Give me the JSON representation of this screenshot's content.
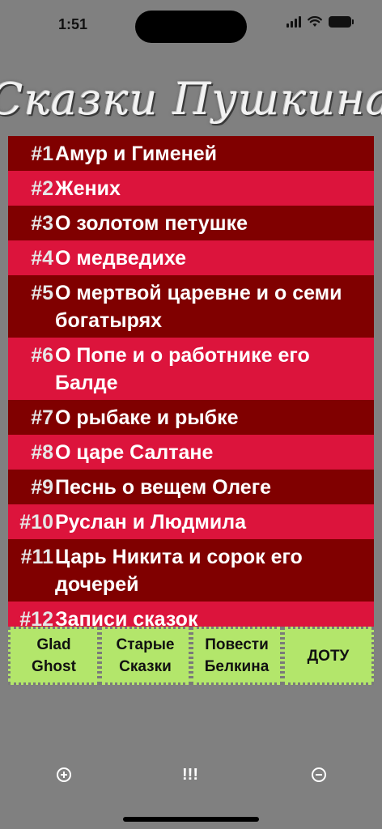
{
  "status_bar": {
    "time": "1:51"
  },
  "header": {
    "title": "Сказки Пушкина"
  },
  "tales": [
    {
      "num": "#1",
      "name": "Амур и Гименей"
    },
    {
      "num": "#2",
      "name": "Жених"
    },
    {
      "num": "#3",
      "name": "О золотом петушке"
    },
    {
      "num": "#4",
      "name": "О медведихе"
    },
    {
      "num": "#5",
      "name": "О мертвой царевне и о семи богатырях"
    },
    {
      "num": "#6",
      "name": "О Попе и о работнике его Балде"
    },
    {
      "num": "#7",
      "name": "О рыбаке и рыбке"
    },
    {
      "num": "#8",
      "name": "О царе Салтане"
    },
    {
      "num": "#9",
      "name": "Песнь о вещем Олеге"
    },
    {
      "num": "#10",
      "name": "Руслан и Людмила"
    },
    {
      "num": "#11",
      "name": "Царь Никита и сорок его дочерей"
    },
    {
      "num": "#12",
      "name": "Записи сказок"
    }
  ],
  "buttons": [
    {
      "label": "Glad\nGhost"
    },
    {
      "label": "Старые\nСказки"
    },
    {
      "label": "Повести\nБелкина"
    },
    {
      "label": "ДОТУ"
    }
  ],
  "toolbar": {
    "zoom_in_icon": "plus-circle-icon",
    "middle_label": "!!!",
    "zoom_out_icon": "minus-circle-icon"
  },
  "colors": {
    "background": "#808080",
    "row_dark": "#800000",
    "row_light": "#dc143c",
    "button_green": "#b3e66b"
  }
}
